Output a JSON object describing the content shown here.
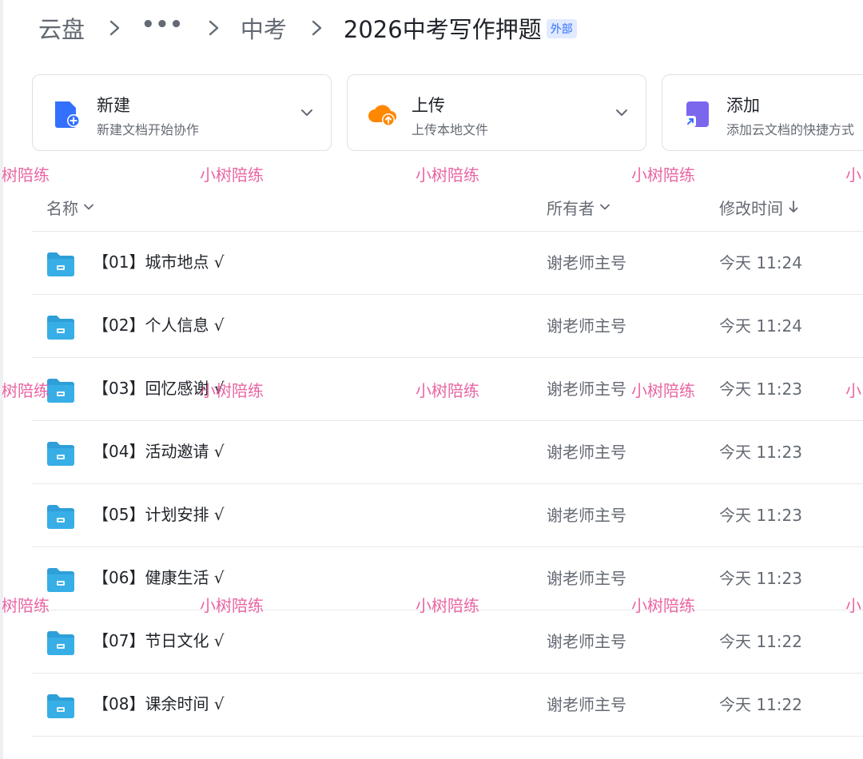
{
  "breadcrumb": {
    "root": "云盘",
    "ellipsis": "•••",
    "parent": "中考",
    "current": "2026中考写作押题",
    "badge": "外部"
  },
  "actions": [
    {
      "title": "新建",
      "subtitle": "新建文档开始协作",
      "icon": "new-doc-icon",
      "color": "#3370ff"
    },
    {
      "title": "上传",
      "subtitle": "上传本地文件",
      "icon": "upload-cloud-icon",
      "color": "#ff8800"
    },
    {
      "title": "添加",
      "subtitle": "添加云文档的快捷方式",
      "icon": "shortcut-icon",
      "color": "#7b67ee"
    }
  ],
  "table": {
    "columns": {
      "name": "名称",
      "owner": "所有者",
      "modified": "修改时间"
    },
    "sort_indicator": "descending",
    "rows": [
      {
        "name": "【01】城市地点 √",
        "owner": "谢老师主号",
        "modified": "今天 11:24"
      },
      {
        "name": "【02】个人信息 √",
        "owner": "谢老师主号",
        "modified": "今天 11:24"
      },
      {
        "name": "【03】回忆感谢 √",
        "owner": "谢老师主号",
        "modified": "今天 11:23"
      },
      {
        "name": "【04】活动邀请 √",
        "owner": "谢老师主号",
        "modified": "今天 11:23"
      },
      {
        "name": "【05】计划安排 √",
        "owner": "谢老师主号",
        "modified": "今天 11:23"
      },
      {
        "name": "【06】健康生活 √",
        "owner": "谢老师主号",
        "modified": "今天 11:23"
      },
      {
        "name": "【07】节日文化 √",
        "owner": "谢老师主号",
        "modified": "今天 11:22"
      },
      {
        "name": "【08】课余时间 √",
        "owner": "谢老师主号",
        "modified": "今天 11:22"
      }
    ]
  },
  "watermark": {
    "text": "小树陪练",
    "partial_left": "树陪练",
    "partial_right": "小",
    "color": "#e8549a"
  },
  "colors": {
    "folder": "#2e9fd8",
    "accent": "#3370ff",
    "text": "#1f2329",
    "muted": "#646a73"
  }
}
